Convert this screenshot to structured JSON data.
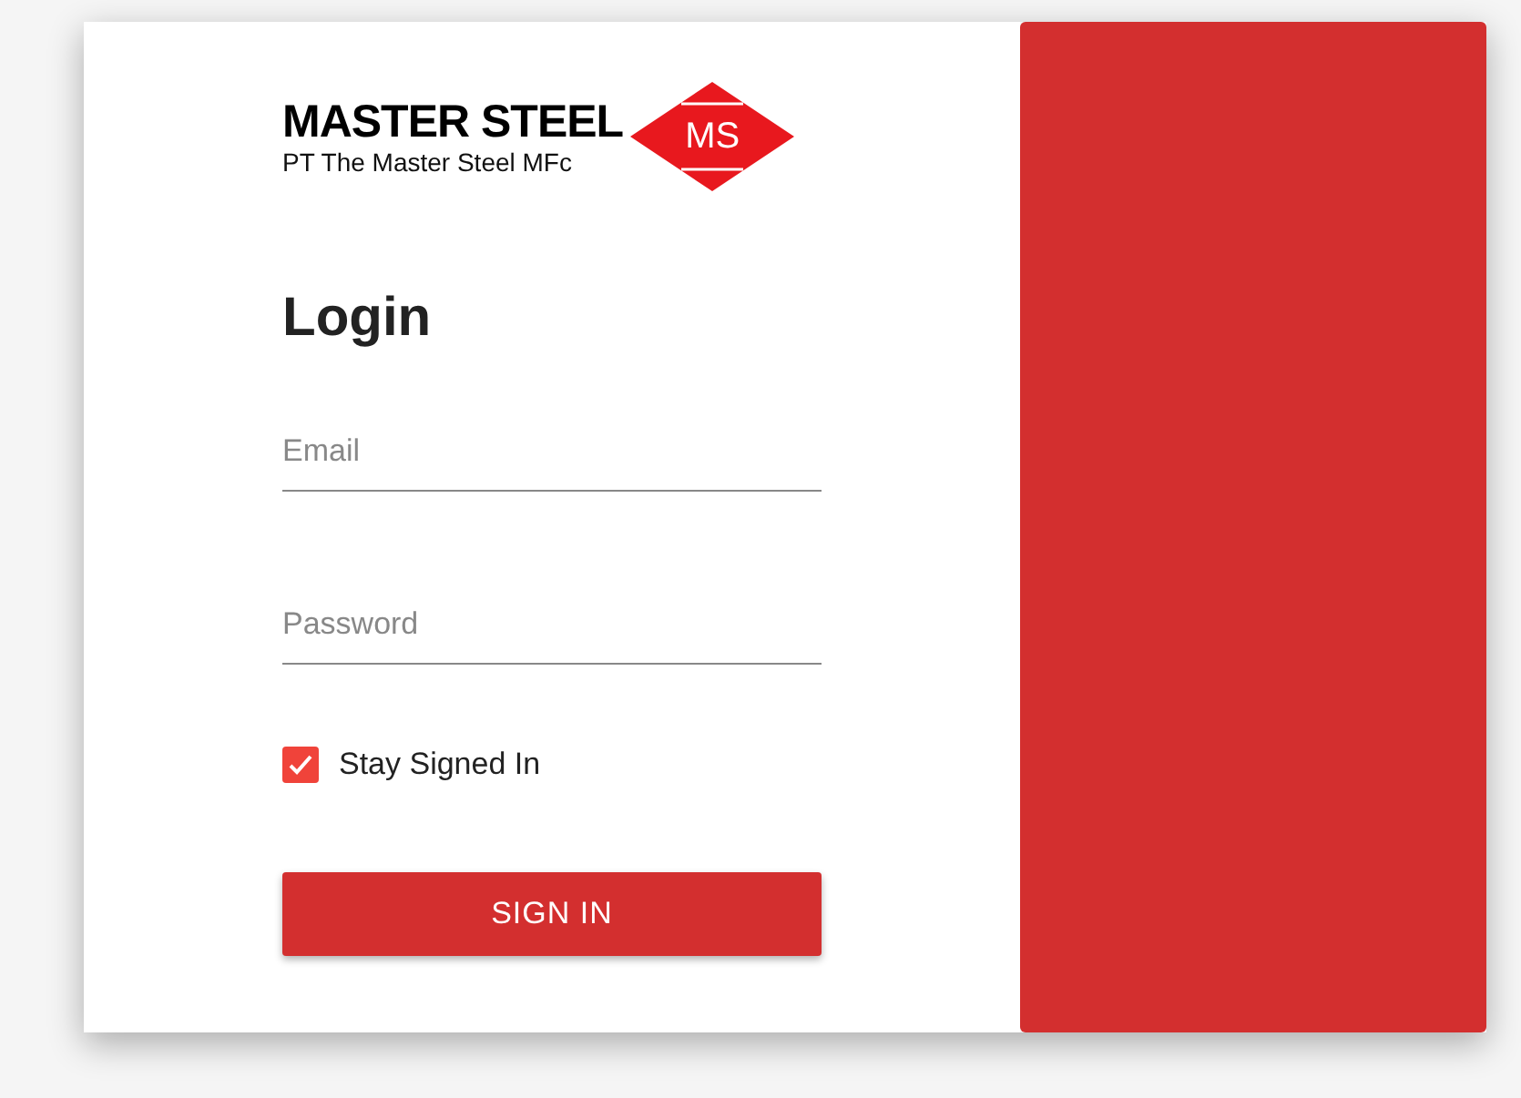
{
  "logo": {
    "name": "MASTER STEEL",
    "subtitle": "PT The Master Steel MFc",
    "mark": "MS"
  },
  "title": "Login",
  "fields": [
    {
      "placeholder": "Email"
    },
    {
      "placeholder": "Password"
    }
  ],
  "stay_signed_in": {
    "label": "Stay Signed In",
    "checked": true
  },
  "button": "SIGN IN"
}
